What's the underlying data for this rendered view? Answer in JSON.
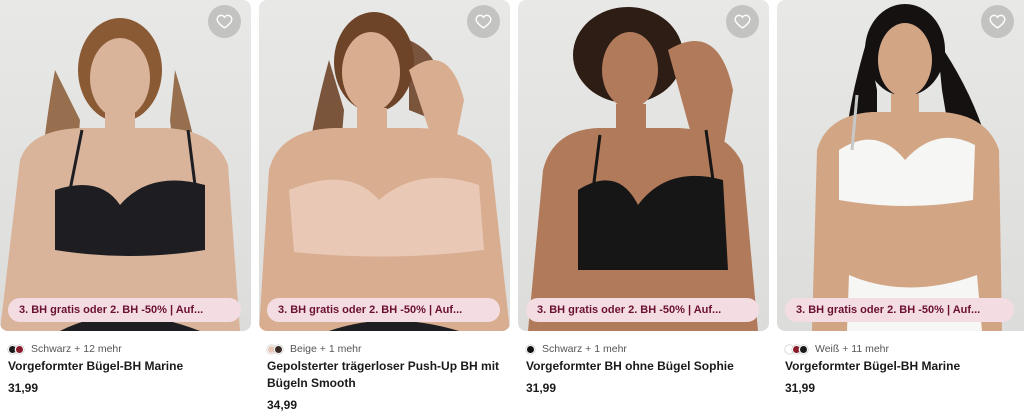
{
  "products": [
    {
      "promo": "3. BH gratis oder 2. BH -50% | Auf...",
      "colors": [
        "#1a1a1a",
        "#8b1a2b"
      ],
      "color_note": "Schwarz + 12 mehr",
      "title": "Vorgeformter Bügel-BH Marine",
      "price": "31,99",
      "bra_color": "#1e1e22",
      "skin": "#d9b49b",
      "hair": "#8a5a35"
    },
    {
      "promo": "3. BH gratis oder 2. BH -50% | Auf...",
      "colors": [
        "#e8c8b8",
        "#3a2a25"
      ],
      "color_note": "Beige + 1 mehr",
      "title": "Gepolsterter trägerloser Push-Up BH mit Bügeln Smooth",
      "price": "34,99",
      "bra_color": "#e9c9b6",
      "skin": "#d8ad90",
      "hair": "#6e4429"
    },
    {
      "promo": "3. BH gratis oder 2. BH -50% | Auf...",
      "colors": [
        "#111111"
      ],
      "color_note": "Schwarz + 1 mehr",
      "title": "Vorgeformter BH ohne Bügel Sophie",
      "price": "31,99",
      "bra_color": "#161616",
      "skin": "#b17a5a",
      "hair": "#2e1d14"
    },
    {
      "promo": "3. BH gratis oder 2. BH -50% | Auf...",
      "colors": [
        "#ffffff",
        "#8b1a2b",
        "#1a1a1a"
      ],
      "color_note": "Weiß + 11 mehr",
      "title": "Vorgeformter Bügel-BH Marine",
      "price": "31,99",
      "bra_color": "#f6f6f4",
      "skin": "#d2a585",
      "hair": "#151111"
    }
  ],
  "icons": {
    "favorite": "heart-outline-icon"
  }
}
